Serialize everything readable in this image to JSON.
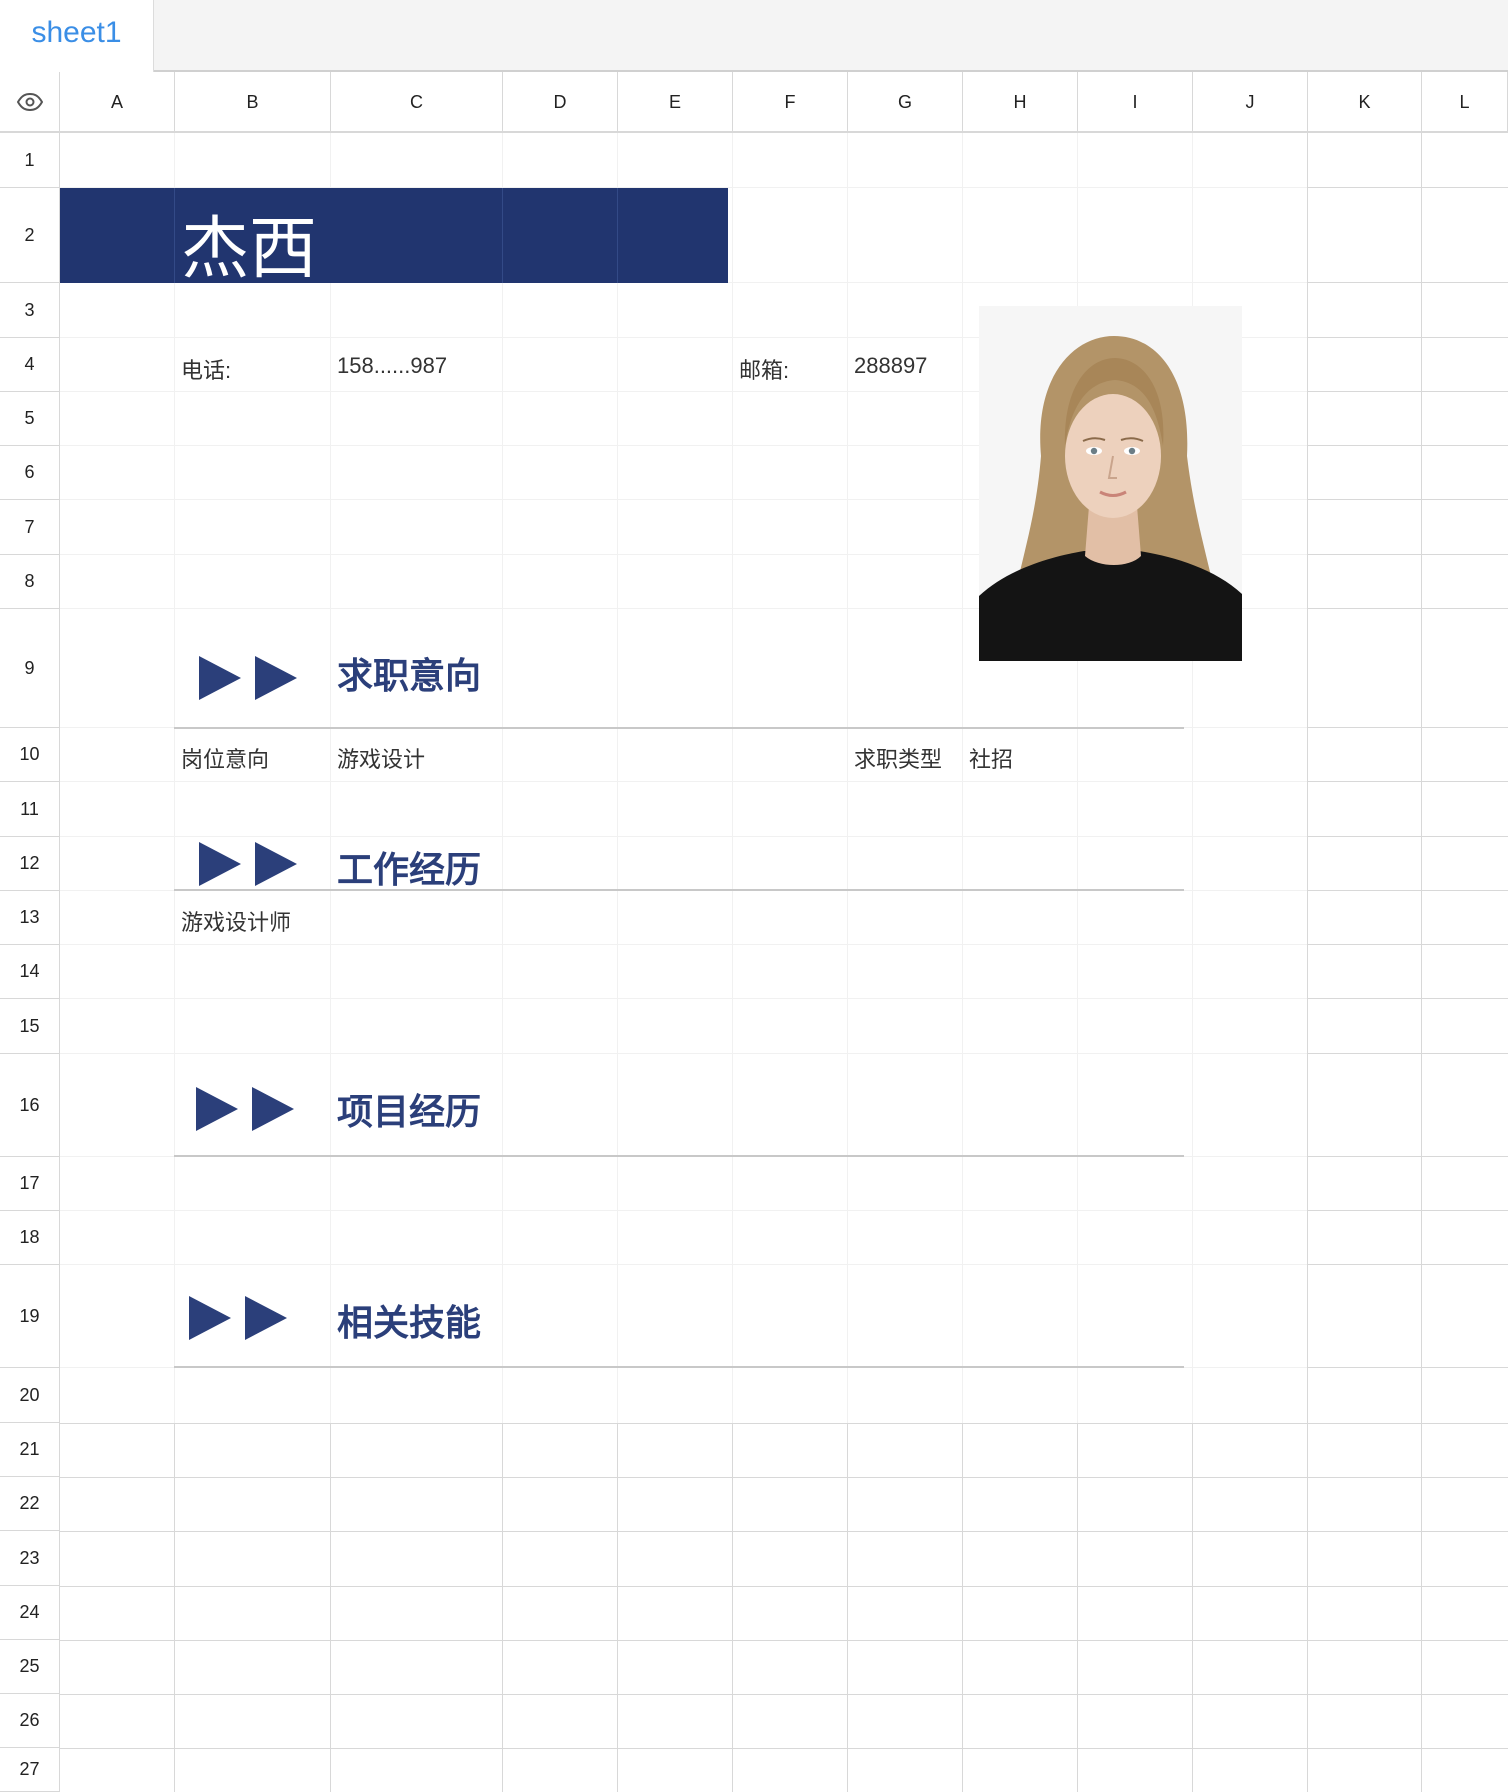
{
  "sheet": {
    "tab_label": "sheet1"
  },
  "columns": [
    "A",
    "B",
    "C",
    "D",
    "E",
    "F",
    "G",
    "H",
    "I",
    "J",
    "K",
    "L"
  ],
  "rows": [
    "1",
    "2",
    "3",
    "4",
    "5",
    "6",
    "7",
    "8",
    "9",
    "10",
    "11",
    "12",
    "13",
    "14",
    "15",
    "16",
    "17",
    "18",
    "19",
    "20",
    "21",
    "22",
    "23",
    "24",
    "25",
    "26",
    "27"
  ],
  "resume": {
    "name": "杰西",
    "phone_label": "电话:",
    "phone_value": "158......987",
    "email_label": "邮箱:",
    "email_value": "288897",
    "section_intent": "求职意向",
    "position_label": "岗位意向",
    "position_value": "游戏设计",
    "type_label": "求职类型",
    "type_value": "社招",
    "section_work": "工作经历",
    "work_title": "游戏设计师",
    "section_project": "项目经历",
    "section_skills": "相关技能"
  },
  "colors": {
    "accent": "#21356f",
    "heading": "#2b3f7a",
    "tab_text": "#3a8ee6"
  },
  "icons": {
    "visibility": "eye-icon",
    "section_marker": "double-triangle-icon"
  }
}
